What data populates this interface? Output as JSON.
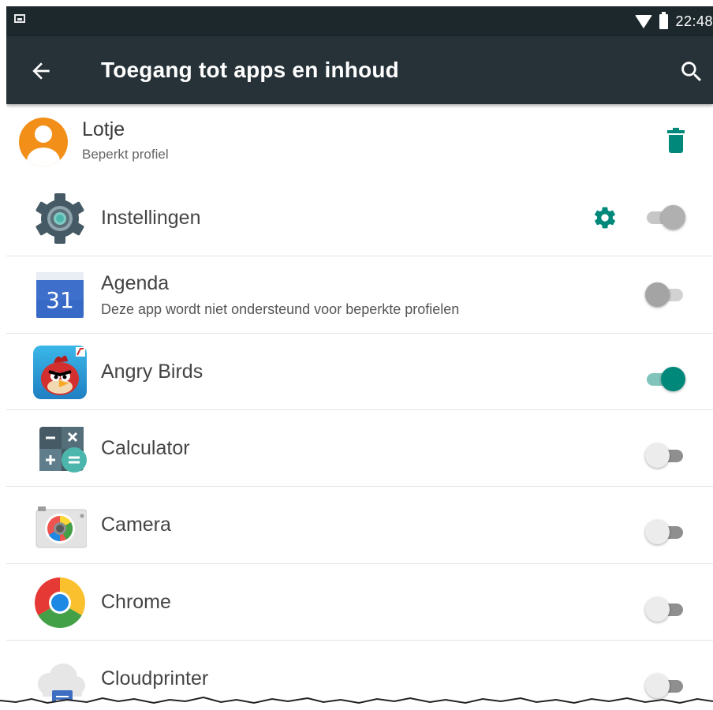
{
  "status_bar": {
    "time": "22:48"
  },
  "toolbar": {
    "title": "Toegang tot apps en inhoud"
  },
  "profile": {
    "name": "Lotje",
    "subtitle": "Beperkt profiel"
  },
  "apps": [
    {
      "label": "Instellingen",
      "toggle": "disabled-on",
      "has_settings": true
    },
    {
      "label": "Agenda",
      "subtitle": "Deze app wordt niet ondersteund voor beperkte profielen",
      "toggle": "disabled-off",
      "icon_text": "31"
    },
    {
      "label": "Angry Birds",
      "toggle": "on"
    },
    {
      "label": "Calculator",
      "toggle": "off"
    },
    {
      "label": "Camera",
      "toggle": "off"
    },
    {
      "label": "Chrome",
      "toggle": "off"
    },
    {
      "label": "Cloudprinter",
      "toggle": "off"
    }
  ],
  "colors": {
    "accent": "#00897b",
    "toolbar": "#263238",
    "status_bar": "#1d282d",
    "avatar": "#f28f19"
  }
}
